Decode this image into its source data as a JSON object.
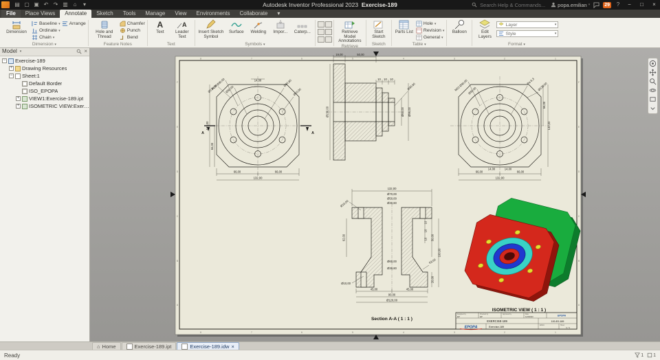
{
  "glyphs": {
    "caret": "▾",
    "close": "×",
    "min": "−",
    "max": "□",
    "home": "⌂",
    "menu": "≡",
    "question": "?",
    "text_icon": "A",
    "search_hint": ""
  },
  "titlebar": {
    "title_app": "Autodesk Inventor Professional 2023",
    "title_doc": "Exercise-189",
    "search_placeholder": "Search Help & Commands...",
    "user": "popa.emilian",
    "badge": "29"
  },
  "ribbon": {
    "tabs": [
      "File",
      "Place Views",
      "Annotate",
      "Sketch",
      "Tools",
      "Manage",
      "View",
      "Environments",
      "Collaborate"
    ],
    "dimension": {
      "label": "Dimension",
      "big": "Dimension",
      "b1": "Baseline",
      "b2": "Ordinate",
      "b3": "Chain",
      "b4": "Arrange"
    },
    "feature_notes": {
      "label": "Feature Notes",
      "big": "Hole and Thread",
      "b1": "Chamfer",
      "b2": "Punch",
      "b3": "Bend"
    },
    "text": {
      "label": "Text",
      "big": "Text",
      "b1": "Leader Text"
    },
    "symbols": {
      "label": "Symbols",
      "big": "Insert Sketch Symbol",
      "b1": "Surface",
      "b2": "Welding",
      "b3": "Impor...",
      "b4": "Caterp..."
    },
    "retrieve": {
      "label": "Retrieve",
      "big": "Retrieve Model Annotations"
    },
    "sketch": {
      "label": "Sketch",
      "big": "Start Sketch"
    },
    "table": {
      "label": "Table",
      "big": "Parts List",
      "b1": "Hole",
      "b2": "Revision",
      "b3": "General"
    },
    "balloon": {
      "big": "Balloon"
    },
    "format": {
      "label": "Format",
      "big": "Edit Layers",
      "layer": "Layer",
      "style": "Style"
    }
  },
  "browser": {
    "panel_title": "Model",
    "tree": [
      {
        "e": "−",
        "label": "Exercise-189"
      },
      {
        "e": "+",
        "label": "Drawing Resources"
      },
      {
        "e": "−",
        "label": "Sheet:1"
      },
      {
        "e": "",
        "label": "Default Border"
      },
      {
        "e": "",
        "label": "ISO_EPOPA"
      },
      {
        "e": "+",
        "label": "VIEW1:Exercise-189.ipt"
      },
      {
        "e": "+",
        "label": "ISOMETRIC VIEW:Exercise-189.ipt"
      }
    ]
  },
  "drawing": {
    "zones_top": [
      "8",
      "7",
      "6",
      "5",
      "4",
      "3",
      "2",
      "1"
    ],
    "zones_bottom": [
      "8",
      "7",
      "6",
      "5",
      "4",
      "3",
      "2",
      "1"
    ],
    "zones_left": [
      "F",
      "E",
      "D",
      "C",
      "B",
      "A"
    ],
    "zones_right": [
      "F",
      "E",
      "D",
      "C",
      "B",
      "A"
    ],
    "front": {
      "top": "14,00",
      "left_outer": "132,00",
      "left_inner": "66,00",
      "bottom_l": "66,00",
      "bottom_r": "66,00",
      "bottom_total": "132,00",
      "lead1": "Ø130,00",
      "lead2": "PCD Ø90,00",
      "lead3": "Ø50,00",
      "lead4": "Ø30,60",
      "lead5": "Ø10,00",
      "sec": "A"
    },
    "side": {
      "t1": "19,00",
      "t2": "50,00",
      "s1": "10",
      "s2": "10",
      "s3": "10",
      "left": "Ø130,00",
      "r1": "Ø60,00",
      "r2": "Ø96,00",
      "lead": "Ø30,60"
    },
    "rightv": {
      "right_outer": "132,00",
      "right_inner": "66,00",
      "bottom_l": "66,00",
      "bottom_r": "66,00",
      "bottom_total": "132,00",
      "ch1": "14,00",
      "ch2": "14,00",
      "lead1": "M22 Ø90,00",
      "lead2": "Ø50,00",
      "lead3": "Ra 6,3",
      "lead4": "Ø130,00"
    },
    "section": {
      "caption": "Section A-A ( 1 : 1 )",
      "top": "132,00",
      "d1": "Ø70,00",
      "d2": "Ø50,00",
      "d3": "Ø30,60",
      "l1": "Ø10,00",
      "l2": "62,00",
      "l3": "Ø10,00",
      "c1": "Ø60,00",
      "c2": "Ø30,60",
      "rc1": "10",
      "rc2": "10",
      "rc3": "10",
      "r1": "50,00",
      "r2": "100,00",
      "r3": "20,00",
      "ang": "63,00",
      "b1": "45,00",
      "b2": "45,00",
      "b3": "90,00",
      "b4": "Ø120,00"
    },
    "iso": {
      "caption": "ISOMETRIC VIEW ( 1 : 1 )"
    }
  },
  "titleblock": {
    "designed_label": "Designed by",
    "designed_val": "EP",
    "checked_label": "Checked by",
    "checked_val": "EP",
    "approved_label": "Approved by",
    "date_label": "Date",
    "date_val": "1/24/2023",
    "small_logo": "EPOPA",
    "part_code": "EXERCISE-189",
    "doc_code": "100-E0-189",
    "company_logo": "EPOPA",
    "title": "Exercise-189",
    "edition_label": "Edition",
    "sheet_label": "Sheet",
    "she_val": "1 / 1",
    "sheet_val": "1 / 1"
  },
  "doctabs": {
    "items": [
      "Home",
      "Exercise-189.ipt",
      "Exercise-189.idw"
    ]
  },
  "statusbar": {
    "ready": "Ready",
    "count1": "1",
    "count2": "1"
  }
}
